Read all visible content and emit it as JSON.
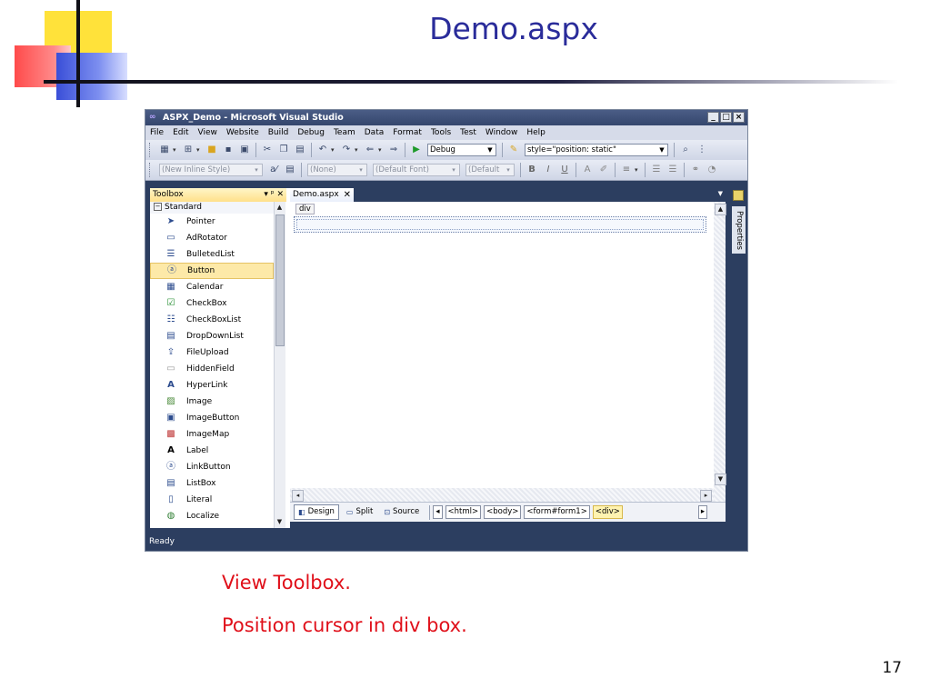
{
  "slide": {
    "title": "Demo.aspx",
    "captions": [
      "View Toolbox.",
      "Position cursor in div box."
    ],
    "page_number": "17"
  },
  "window": {
    "title": "ASPX_Demo - Microsoft Visual Studio",
    "menu": [
      "File",
      "Edit",
      "View",
      "Website",
      "Build",
      "Debug",
      "Team",
      "Data",
      "Format",
      "Tools",
      "Test",
      "Window",
      "Help"
    ],
    "toolbar1": {
      "config": "Debug",
      "style": "style=\"position: static\""
    },
    "toolbar2": {
      "style_combo": "(New Inline Style)",
      "block_combo": "(None)",
      "font_combo": "(Default Font)",
      "size_combo": "(Default"
    },
    "status": "Ready"
  },
  "toolbox": {
    "title": "Toolbox",
    "category": "Standard",
    "items": [
      "Pointer",
      "AdRotator",
      "BulletedList",
      "Button",
      "Calendar",
      "CheckBox",
      "CheckBoxList",
      "DropDownList",
      "FileUpload",
      "HiddenField",
      "HyperLink",
      "Image",
      "ImageButton",
      "ImageMap",
      "Label",
      "LinkButton",
      "ListBox",
      "Literal",
      "Localize"
    ],
    "selected": "Button"
  },
  "editor": {
    "tab": "Demo.aspx",
    "div_tag": "div",
    "views": [
      "Design",
      "Split",
      "Source"
    ],
    "breadcrumbs": [
      "<html>",
      "<body>",
      "<form#form1>",
      "<div>"
    ]
  },
  "properties": {
    "label": "Properties"
  }
}
